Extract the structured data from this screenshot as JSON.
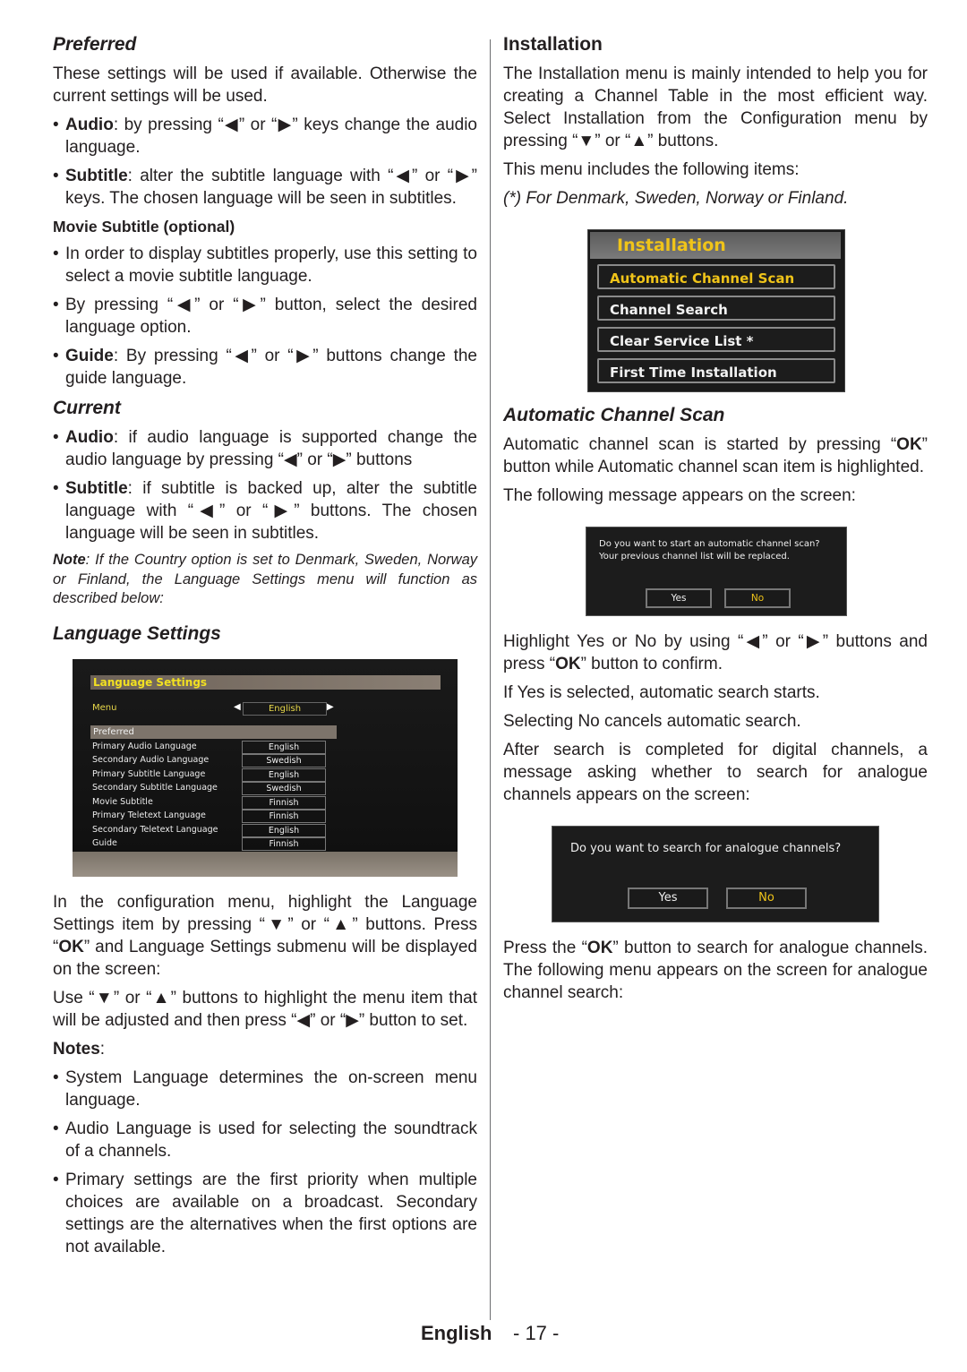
{
  "left": {
    "preferred": {
      "heading": "Preferred",
      "intro": "These settings will be used if available. Otherwise the current settings will be used.",
      "bullets": [
        {
          "term": "Audio",
          "text": ": by pressing “◀” or “▶” keys change the audio language."
        },
        {
          "term": "Subtitle",
          "text": ": alter the subtitle language with “◀” or “▶” keys. The chosen language will be seen in subtitles."
        }
      ]
    },
    "movie_subtitle": {
      "heading": "Movie Subtitle (optional)",
      "bullets": [
        {
          "term": "",
          "text": "In order to display subtitles properly, use this setting to select a movie subtitle language."
        },
        {
          "term": "",
          "text": "By pressing “◀” or “▶” button, select the desired language option."
        },
        {
          "term": "Guide",
          "text": ": By pressing “◀” or “▶” buttons change the guide language."
        }
      ]
    },
    "current": {
      "heading": "Current",
      "bullets": [
        {
          "term": "Audio",
          "text": ":  if audio language is supported change the audio language by pressing “◀” or “▶” buttons"
        },
        {
          "term": "Subtitle",
          "text": ": if subtitle is backed up, alter the subtitle language with “◀” or “▶” buttons. The chosen language will be seen in subtitles."
        }
      ]
    },
    "note": {
      "label": "Note",
      "text": ": If the Country option is set to Denmark, Sweden, Norway or Finland, the Language Settings menu will function as described below:"
    },
    "language_settings": {
      "heading": "Language Settings",
      "screen": {
        "title": "Language Settings",
        "menu_label": "Menu",
        "menu_value": "English",
        "section_label": "Preferred",
        "rows": [
          {
            "label": "Primary Audio Language",
            "value": "English"
          },
          {
            "label": "Secondary Audio Language",
            "value": "Swedish"
          },
          {
            "label": "Primary Subtitle Language",
            "value": "English"
          },
          {
            "label": "Secondary Subtitle Language",
            "value": "Swedish"
          },
          {
            "label": "Movie Subtitle",
            "value": "Finnish"
          },
          {
            "label": "Primary Teletext Language",
            "value": "Finnish"
          },
          {
            "label": "Secondary Teletext Language",
            "value": "English"
          },
          {
            "label": "Guide",
            "value": "Finnish"
          }
        ]
      },
      "para1_pre": "In the configuration menu, highlight the Language Settings item by pressing “▼” or “▲” buttons. Press “",
      "para1_ok": "OK",
      "para1_post": "” and Language Settings submenu will be displayed on the screen:",
      "para2": "Use “▼” or “▲” buttons to highlight the menu item that will be adjusted and then press “◀” or “▶” button to set."
    },
    "notes": {
      "label": "Notes",
      "colon": ":",
      "bullets": [
        "System Language determines the on-screen menu language.",
        "Audio Language is used for selecting the soundtrack of a channels.",
        "Primary settings are the first priority when multiple choices are available on a broadcast. Secondary settings are the alternatives when the first options are not available."
      ]
    }
  },
  "right": {
    "installation": {
      "heading": "Installation",
      "para1": "The Installation menu is mainly intended to help you for creating a Channel Table in the most efficient way. Select Installation from the Configuration menu by pressing “▼” or “▲” buttons.",
      "para2": "This menu includes the following items:",
      "footnote": "(*) For Denmark, Sweden, Norway or Finland.",
      "screen": {
        "title": "Installation",
        "items": [
          "Automatic Channel Scan",
          "Channel Search",
          "Clear Service List *",
          "First Time Installation"
        ]
      }
    },
    "auto_scan": {
      "heading": "Automatic Channel Scan",
      "para1_pre": "Automatic channel scan is started by pressing “",
      "para1_ok": "OK",
      "para1_post": "” button while Automatic channel scan item is highlighted.",
      "para2": "The following message appears on the screen:",
      "dialog1": {
        "message": "Do you want to start an automatic channel scan? Your previous channel list will be replaced.",
        "yes": "Yes",
        "no": "No"
      },
      "para3_pre": "Highlight Yes or No by using “◀” or “▶” buttons and press “",
      "para3_ok": "OK",
      "para3_post": "” button to confirm.",
      "para4": "If Yes is selected, automatic search starts.",
      "para5": "Selecting No cancels automatic search.",
      "para6": "After search is completed for digital channels, a message asking whether to search for analogue channels appears on the screen:",
      "dialog2": {
        "message": "Do you want to search for analogue channels?",
        "yes": "Yes",
        "no": "No"
      },
      "para7_pre": "Press the “",
      "para7_ok": "OK",
      "para7_post": "” button to search for analogue channels. The following menu appears on the screen for analogue channel search:"
    }
  },
  "footer": {
    "language": "English",
    "page": "- 17 -"
  }
}
